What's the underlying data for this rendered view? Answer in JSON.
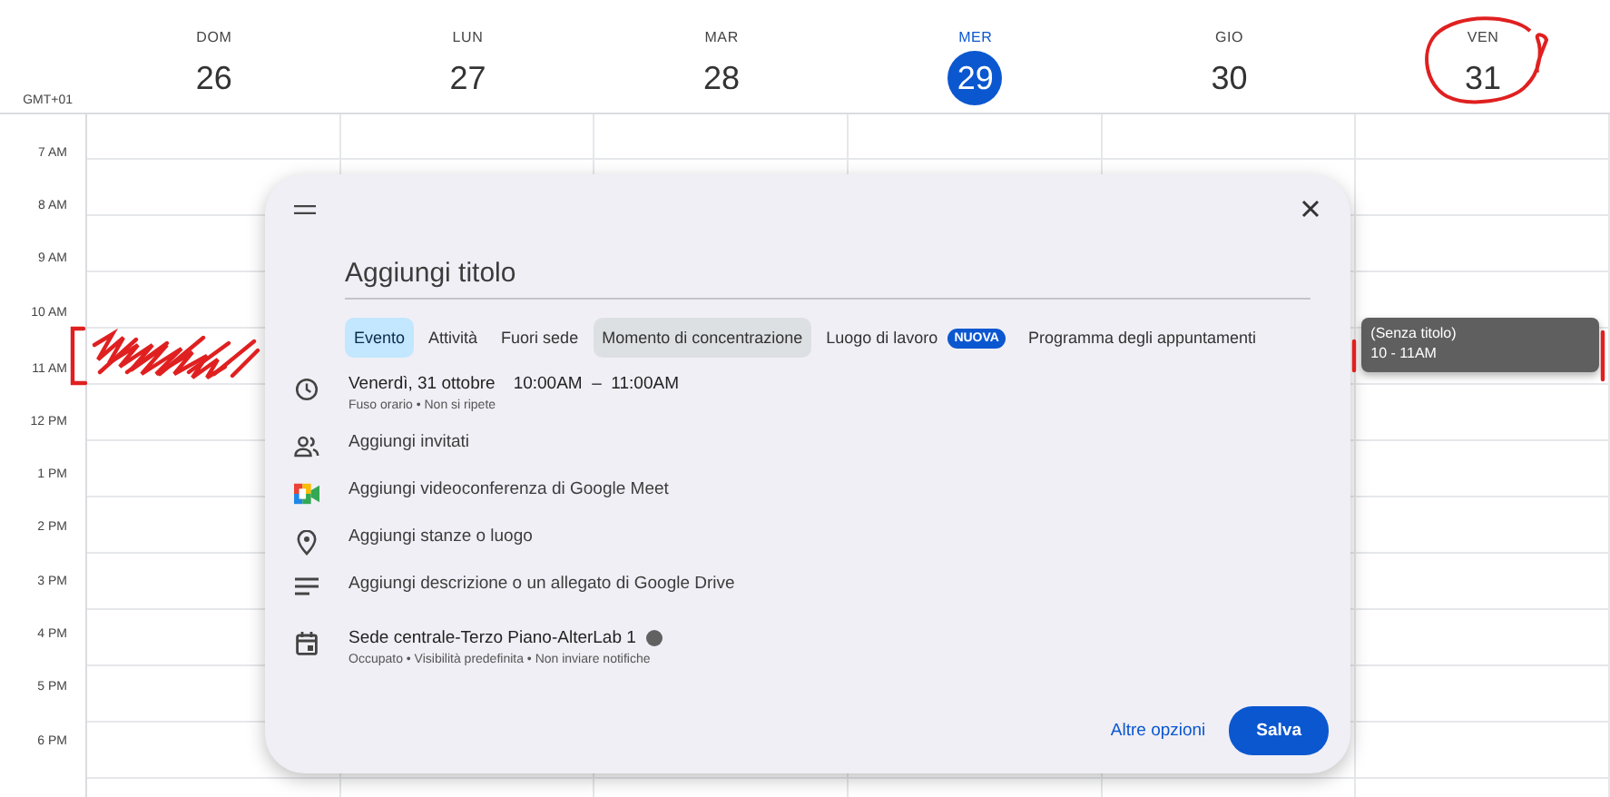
{
  "timezone": "GMT+01",
  "days": [
    {
      "weekday": "DOM",
      "date": "26",
      "selected": false
    },
    {
      "weekday": "LUN",
      "date": "27",
      "selected": false
    },
    {
      "weekday": "MAR",
      "date": "28",
      "selected": false
    },
    {
      "weekday": "MER",
      "date": "29",
      "selected": true
    },
    {
      "weekday": "GIO",
      "date": "30",
      "selected": false
    },
    {
      "weekday": "VEN",
      "date": "31",
      "selected": false
    }
  ],
  "hours": [
    "7 AM",
    "8 AM",
    "9 AM",
    "10 AM",
    "11 AM",
    "12 PM",
    "1 PM",
    "2 PM",
    "3 PM",
    "4 PM",
    "5 PM",
    "6 PM"
  ],
  "event": {
    "title": "(Senza titolo)",
    "time": "10 - 11AM"
  },
  "dialog": {
    "title_placeholder": "Aggiungi titolo",
    "types": [
      {
        "label": "Evento",
        "selected": true,
        "highlighted": false
      },
      {
        "label": "Attività",
        "selected": false,
        "highlighted": false
      },
      {
        "label": "Fuori sede",
        "selected": false,
        "highlighted": false
      },
      {
        "label": "Momento di concentrazione",
        "selected": false,
        "highlighted": true
      },
      {
        "label": "Luogo di lavoro",
        "selected": false,
        "highlighted": false,
        "badge": "NUOVA"
      },
      {
        "label": "Programma degli appuntamenti",
        "selected": false,
        "highlighted": false
      }
    ],
    "details": [
      {
        "kind": "datetime",
        "date": "Venerdì, 31 ottobre",
        "time": "10:00AM  –  11:00AM",
        "sub": "Fuso orario • Non si ripete"
      },
      {
        "kind": "guests",
        "text": "Aggiungi invitati"
      },
      {
        "kind": "meet",
        "text": "Aggiungi videoconferenza di Google Meet"
      },
      {
        "kind": "location",
        "text": "Aggiungi stanze o luogo"
      },
      {
        "kind": "description",
        "text": "Aggiungi descrizione o un allegato di Google Drive"
      },
      {
        "kind": "calendar",
        "text": "Sede centrale-Terzo Piano-AlterLab 1",
        "color": "#616161",
        "sub": "Occupato • Visibilità predefinita • Non inviare notifiche"
      }
    ],
    "more_options": "Altre opzioni",
    "save": "Salva"
  }
}
